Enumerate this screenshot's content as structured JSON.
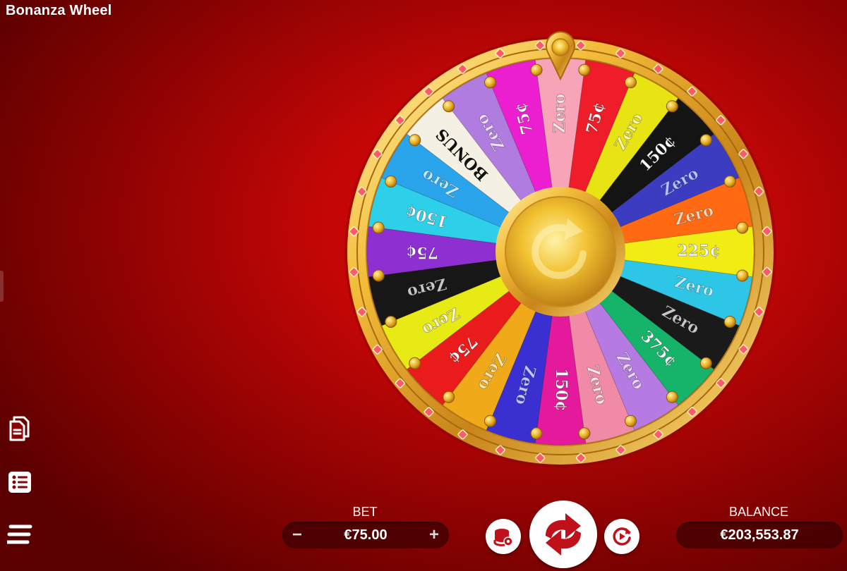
{
  "app": {
    "title": "Bonanza Wheel"
  },
  "wheel": {
    "center_icon": "replay-arrow-icon",
    "pointer_icon": "gold-pin-icon",
    "segments": [
      {
        "label": "Zero",
        "color": "#f7a3b8",
        "text_color": "#f7e3e9"
      },
      {
        "label": "75¢",
        "color": "#ef1c2a",
        "text_color": "#ffffff"
      },
      {
        "label": "Zero",
        "color": "#e8e313",
        "text_color": "#fff8a0"
      },
      {
        "label": "150¢",
        "color": "#141414",
        "text_color": "#ffffff"
      },
      {
        "label": "Zero",
        "color": "#3b3cbf",
        "text_color": "#b9c2ff"
      },
      {
        "label": "Zero",
        "color": "#ff6a13",
        "text_color": "#ffd7b8"
      },
      {
        "label": "225¢",
        "color": "#f1ec14",
        "text_color": "#ffffff"
      },
      {
        "label": "Zero",
        "color": "#2ec6e6",
        "text_color": "#b9f2ff"
      },
      {
        "label": "Zero",
        "color": "#1a1a1a",
        "text_color": "#c8c8c8"
      },
      {
        "label": "375¢",
        "color": "#16b36a",
        "text_color": "#ffffff"
      },
      {
        "label": "Zero",
        "color": "#b57be2",
        "text_color": "#ecd8ff"
      },
      {
        "label": "Zero",
        "color": "#f08aa6",
        "text_color": "#ffe3ec"
      },
      {
        "label": "150¢",
        "color": "#e5199c",
        "text_color": "#ffffff"
      },
      {
        "label": "Zero",
        "color": "#3a2fd0",
        "text_color": "#c1c6ff"
      },
      {
        "label": "Zero",
        "color": "#f0a918",
        "text_color": "#ffe9b3"
      },
      {
        "label": "75¢",
        "color": "#ea1b1b",
        "text_color": "#ffffff"
      },
      {
        "label": "Zero",
        "color": "#e7ea14",
        "text_color": "#fffad0"
      },
      {
        "label": "Zero",
        "color": "#171717",
        "text_color": "#c8c8c8"
      },
      {
        "label": "75¢",
        "color": "#8e2fd1",
        "text_color": "#ffffff"
      },
      {
        "label": "150¢",
        "color": "#2ecfe8",
        "text_color": "#ffffff"
      },
      {
        "label": "Zero",
        "color": "#2aa5ec",
        "text_color": "#c4ecff"
      },
      {
        "label": "BONUS",
        "color": "#f4f0e4",
        "text_color": "#111111"
      },
      {
        "label": "Zero",
        "color": "#b07ce0",
        "text_color": "#efdcff"
      },
      {
        "label": "75¢",
        "color": "#ec1fd0",
        "text_color": "#ffffff"
      }
    ]
  },
  "bet": {
    "label": "BET",
    "value": "€75.00",
    "minus": "−",
    "plus": "+"
  },
  "balance": {
    "label": "BALANCE",
    "value": "€203,553.87"
  },
  "controls": {
    "spin_icon": "spin-arrows-icon",
    "chips_icon": "coin-stack-icon",
    "autoplay_icon": "autoplay-icon"
  },
  "sidebar": {
    "icons": [
      "paytable-icon",
      "history-list-icon",
      "menu-icon"
    ]
  },
  "colors": {
    "background": "#c20606",
    "gold": "#f0b429",
    "pill": "#3c0000"
  }
}
